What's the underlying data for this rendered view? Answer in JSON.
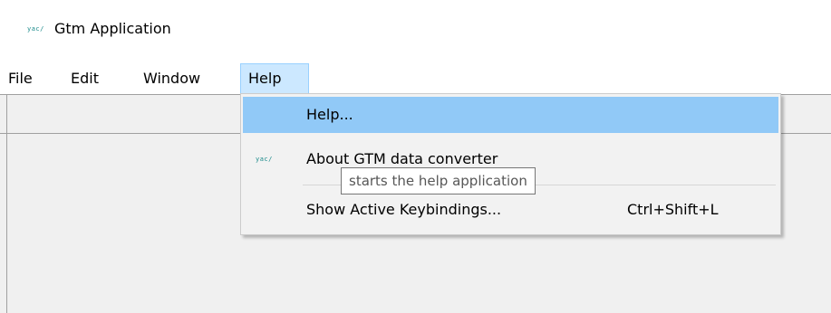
{
  "window": {
    "title": "Gtm Application",
    "icon": "gtm-app-icon",
    "icon_glyph": "yac/"
  },
  "menu_bar": {
    "items": [
      {
        "label": "File"
      },
      {
        "label": "Edit"
      },
      {
        "label": "Window"
      },
      {
        "label": "Help",
        "active": true
      }
    ]
  },
  "help_menu": {
    "items": [
      {
        "label": "Help...",
        "highlighted": true
      },
      {
        "label": "About GTM data converter",
        "icon": "gtm-app-icon"
      },
      {
        "label": "Show Active Keybindings...",
        "shortcut": "Ctrl+Shift+L"
      }
    ]
  },
  "tooltip": {
    "text": "starts the help application"
  },
  "colors": {
    "menu_highlight": "#91c9f7",
    "menubar_active": "#cce8ff",
    "workspace_bg": "#f0f0f0",
    "icon_color": "#1a8a8a"
  }
}
